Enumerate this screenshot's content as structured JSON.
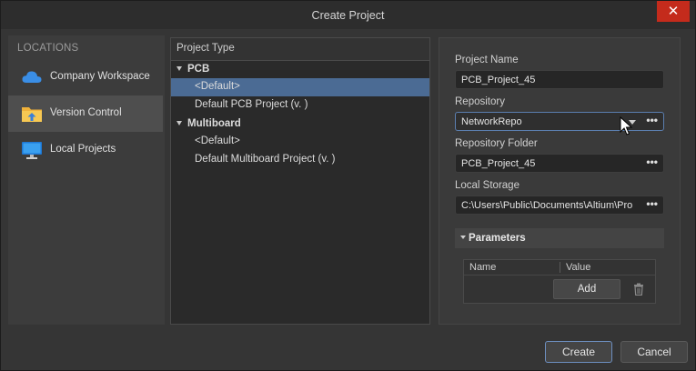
{
  "window": {
    "title": "Create Project",
    "close_glyph": "✕"
  },
  "locations": {
    "heading": "LOCATIONS",
    "items": [
      {
        "label": "Company Workspace",
        "icon": "cloud-icon",
        "selected": false
      },
      {
        "label": "Version Control",
        "icon": "folder-upload-icon",
        "selected": true
      },
      {
        "label": "Local Projects",
        "icon": "monitor-icon",
        "selected": false
      }
    ]
  },
  "project_type": {
    "header": "Project Type",
    "groups": [
      {
        "label": "PCB",
        "items": [
          "<Default>",
          "Default PCB Project (v. )"
        ]
      },
      {
        "label": "Multiboard",
        "items": [
          "<Default>",
          "Default Multiboard Project (v. )"
        ]
      }
    ],
    "selected": "PCB/<Default>"
  },
  "form": {
    "project_name_label": "Project Name",
    "project_name_value": "PCB_Project_45",
    "repository_label": "Repository",
    "repository_value": "NetworkRepo",
    "repository_folder_label": "Repository Folder",
    "repository_folder_value": "PCB_Project_45",
    "local_storage_label": "Local Storage",
    "local_storage_value": "C:\\Users\\Public\\Documents\\Altium\\Pro",
    "more_glyph": "•••"
  },
  "parameters": {
    "title": "Parameters",
    "columns": [
      "Name",
      "Value"
    ],
    "add_label": "Add"
  },
  "footer": {
    "create_label": "Create",
    "cancel_label": "Cancel"
  },
  "colors": {
    "accent": "#4b6b94",
    "close": "#c42b1c",
    "focus": "#5b7fb0"
  }
}
